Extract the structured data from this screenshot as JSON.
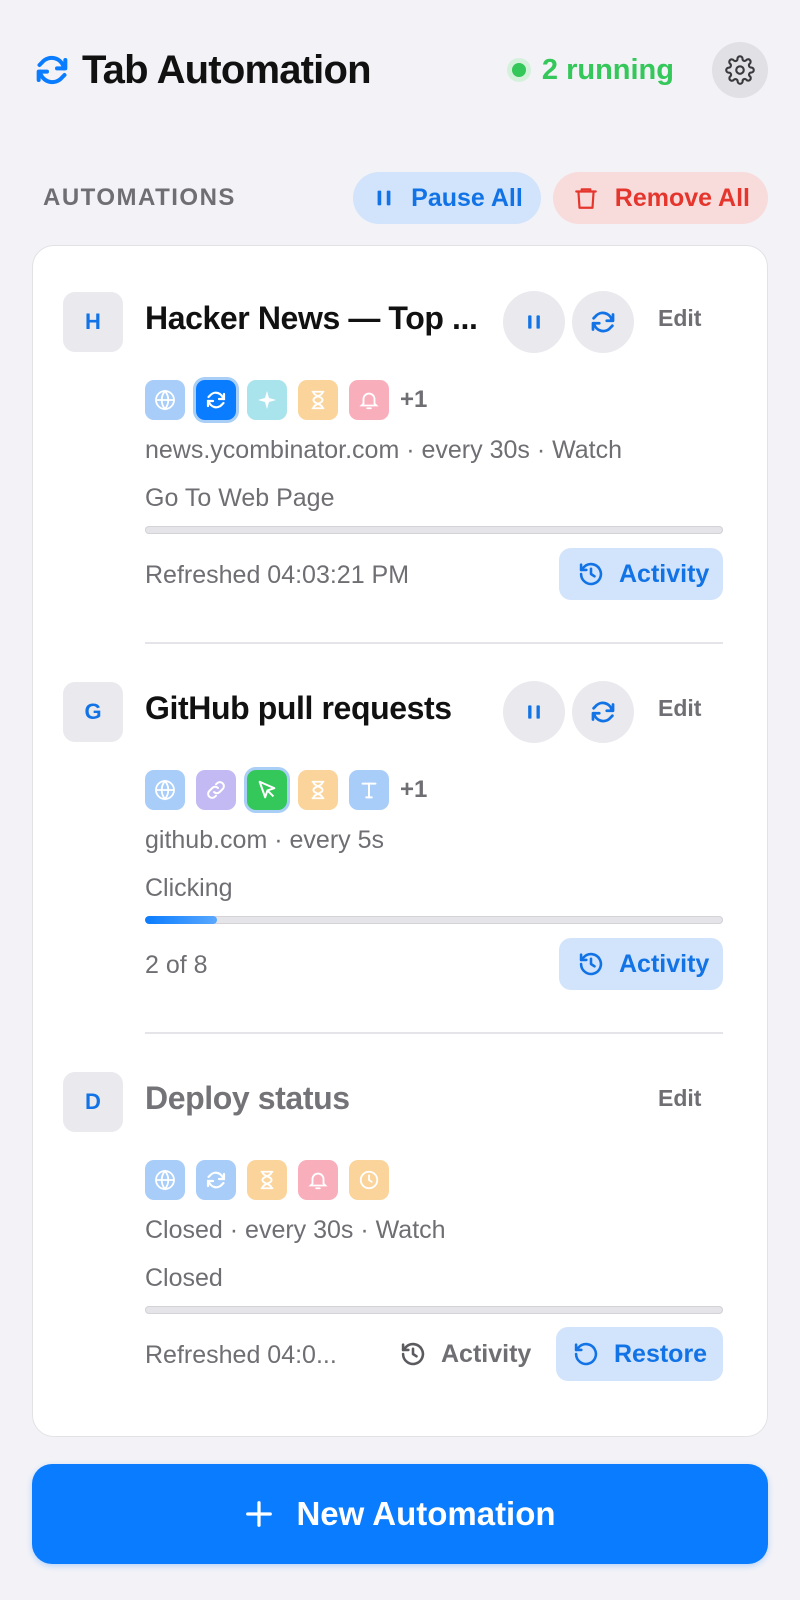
{
  "header": {
    "title": "Tab Automation",
    "running": "2 running",
    "logo_icon": "refresh-icon",
    "settings_icon": "gear-icon"
  },
  "section": {
    "title": "AUTOMATIONS",
    "pause_all": "Pause All",
    "remove_all": "Remove All"
  },
  "automations": [
    {
      "initial": "H",
      "name": "Hacker News — Top ...",
      "steps": [
        "globe-icon",
        "refresh-icon",
        "sparkle-icon",
        "hourglass-icon",
        "bell-icon"
      ],
      "more": "+1",
      "meta": "news.ycombinator.com · every 30s · Watch",
      "status": "Go To Web Page",
      "progress": 0,
      "footnote": "Refreshed 04:03:21 PM",
      "edit": "Edit",
      "activity": "Activity"
    },
    {
      "initial": "G",
      "name": "GitHub pull requests",
      "steps": [
        "globe-icon",
        "link-icon",
        "cursor-icon",
        "hourglass-icon",
        "text-icon"
      ],
      "more": "+1",
      "meta": "github.com · every 5s",
      "status": "Clicking",
      "progress": 0.125,
      "footnote": "2 of 8",
      "edit": "Edit",
      "activity": "Activity"
    },
    {
      "initial": "D",
      "name": "Deploy status",
      "steps": [
        "globe-icon",
        "refresh-icon",
        "hourglass-icon",
        "bell-icon",
        "clock-icon"
      ],
      "meta": "Closed · every 30s · Watch",
      "status": "Closed",
      "progress": 0,
      "footnote": "Refreshed 04:0...",
      "edit": "Edit",
      "activity": "Activity",
      "restore": "Restore"
    }
  ],
  "new_button": "New Automation",
  "colors": {
    "accent": "#0a7cff",
    "running": "#34c759",
    "danger": "#e5362e"
  }
}
